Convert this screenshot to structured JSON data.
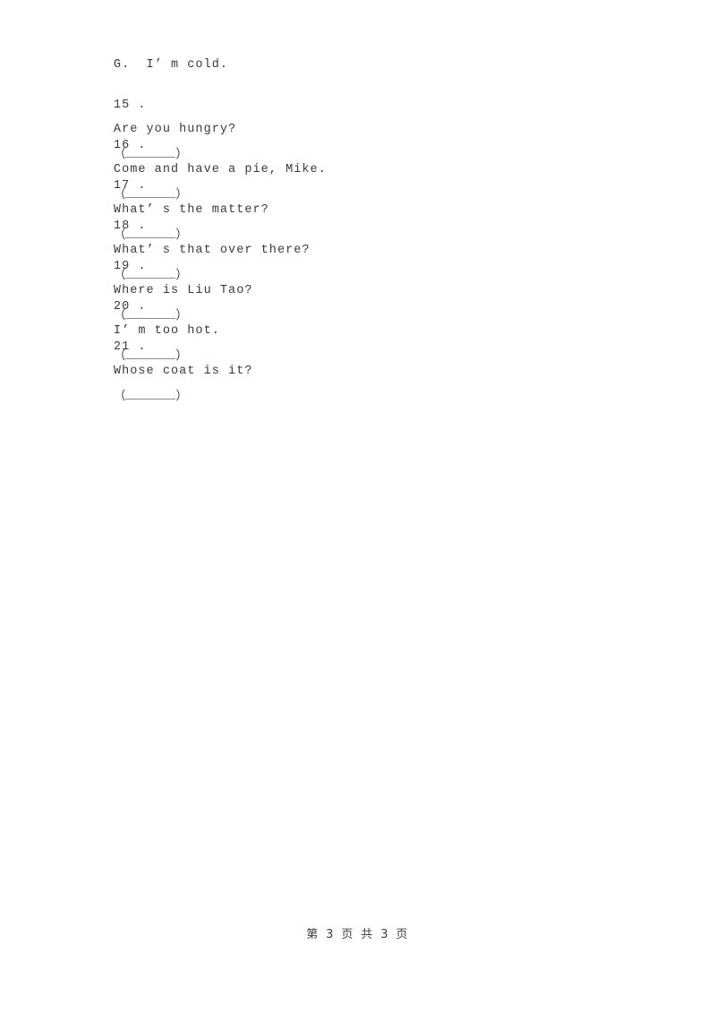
{
  "document": {
    "page_background": "#ffffff",
    "text_color": "#3a3a3a",
    "blank_rule_color": "#8a8a8a"
  },
  "body_lines": [
    {
      "id": "option-g",
      "kind": "option",
      "label": "G.",
      "text": "I’ m cold.",
      "has_blank": false,
      "full_text": "G.  I’ m cold."
    },
    {
      "id": "item-15",
      "kind": "question",
      "number": "15 .",
      "text": "Are you hungry?",
      "has_blank": true,
      "gap_before_blank": "small",
      "blank_open": "（",
      "blank_close": "）",
      "full_text": "15 . Are you hungry? （______）"
    },
    {
      "id": "item-16",
      "kind": "question",
      "number": "16 .",
      "text": "Come and have a pie, Mike.",
      "has_blank": true,
      "gap_before_blank": "large",
      "blank_open": "（",
      "blank_close": "）",
      "full_text": "16 . Come and have a pie, Mike.   （______）"
    },
    {
      "id": "item-17",
      "kind": "question",
      "number": "17 .",
      "text": "What’ s the matter?",
      "has_blank": true,
      "gap_before_blank": "medium",
      "blank_open": "（",
      "blank_close": "）",
      "full_text": "17 . What’ s the matter?  （______）"
    },
    {
      "id": "item-18",
      "kind": "question",
      "number": "18 .",
      "text": "What’ s that over there?",
      "has_blank": true,
      "gap_before_blank": "medium",
      "blank_open": "（",
      "blank_close": "）",
      "full_text": "18 . What’ s that over there?  （______）"
    },
    {
      "id": "item-19",
      "kind": "question",
      "number": "19 .",
      "text": "Where is Liu Tao?",
      "has_blank": true,
      "gap_before_blank": "medium",
      "blank_open": "（",
      "blank_close": "）",
      "full_text": "19 . Where is Liu Tao?  （______）"
    },
    {
      "id": "item-20",
      "kind": "question",
      "number": "20 .",
      "text": "I’ m too hot.",
      "has_blank": true,
      "gap_before_blank": "small",
      "blank_open": "（",
      "blank_close": "）",
      "full_text": "20 . I’ m too hot. （______）"
    },
    {
      "id": "item-21",
      "kind": "question",
      "number": "21 .",
      "text": "Whose coat is it?",
      "has_blank": true,
      "gap_before_blank": "small",
      "blank_open": "（",
      "blank_close": "）",
      "full_text": "21 . Whose coat is it? （______）"
    }
  ],
  "footer": {
    "page_label": "第 3 页 共 3 页",
    "current_page": "3",
    "total_pages": "3"
  }
}
